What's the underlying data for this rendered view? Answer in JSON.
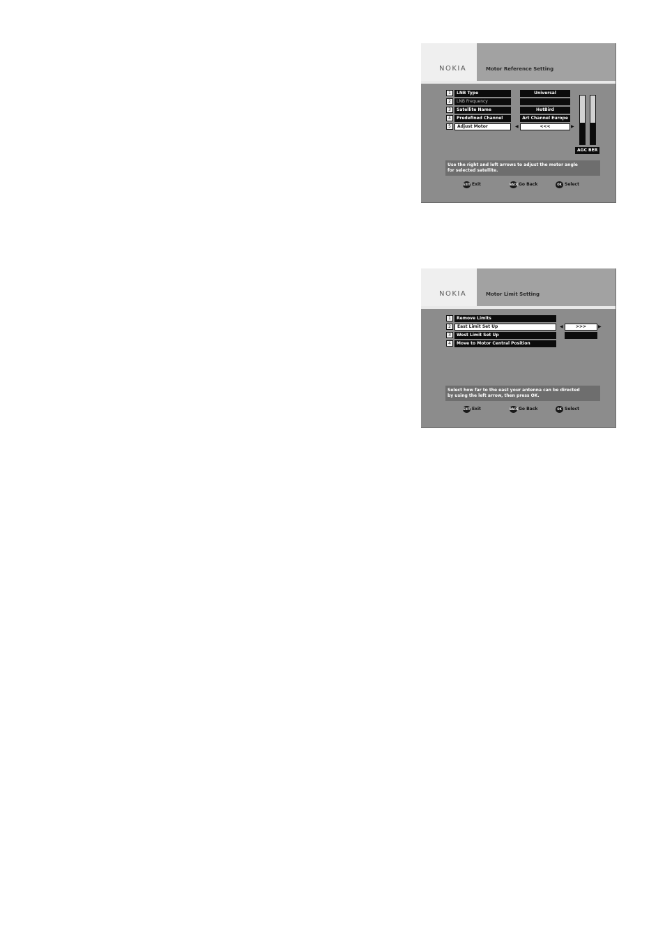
{
  "screen1": {
    "logo": "NOKIA",
    "title": "Motor Reference Setting",
    "items": [
      {
        "num": "1",
        "label": "LNB Type",
        "value": "Universal"
      },
      {
        "num": "2",
        "label": "LNB Frequency",
        "value": ""
      },
      {
        "num": "3",
        "label": "Satellite Name",
        "value": "HotBird"
      },
      {
        "num": "4",
        "label": "Predefined Channel",
        "value": "Art Channel Europe"
      },
      {
        "num": "5",
        "label": "Adjust Motor",
        "value": "<<<"
      }
    ],
    "meter_label": "AGC BER",
    "meter_agc_level": 0.45,
    "meter_ber_level": 0.45,
    "info_line1": "Use the right and left arrows to adjust the motor angle",
    "info_line2": "for selected satellite.",
    "footer": {
      "exit_key": "EXIT",
      "exit_label": "Exit",
      "back_key": "BACK",
      "back_label": "Go Back",
      "ok_key": "OK",
      "ok_label": "Select"
    }
  },
  "screen2": {
    "logo": "NOKIA",
    "title": "Motor Limit Setting",
    "items": [
      {
        "num": "1",
        "label": "Remove Limits"
      },
      {
        "num": "2",
        "label": "East Limit Set Up"
      },
      {
        "num": "3",
        "label": "West Limit Set Up"
      },
      {
        "num": "4",
        "label": "Move to Motor Central Position"
      }
    ],
    "value": ">>>",
    "value2": "",
    "info_line1": "Select how far to the east your antenna can be directed",
    "info_line2": "by using the left arrow, then press OK.",
    "footer": {
      "exit_key": "EXIT",
      "exit_label": "Exit",
      "back_key": "BACK",
      "back_label": "Go Back",
      "ok_key": "OK",
      "ok_label": "Select"
    }
  }
}
